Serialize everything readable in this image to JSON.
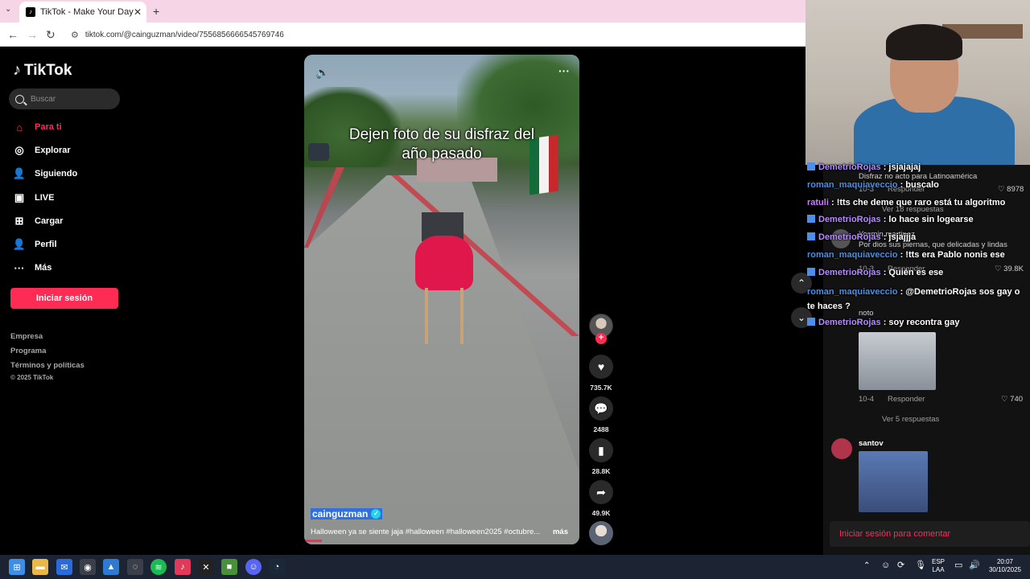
{
  "browser": {
    "tab_title": "TikTok - Make Your Day",
    "url": "tiktok.com/@cainguzman/video/7556856666545769746"
  },
  "sidebar": {
    "logo": "TikTok",
    "search_placeholder": "Buscar",
    "items": [
      {
        "label": "Para ti",
        "icon": "home-icon"
      },
      {
        "label": "Explorar",
        "icon": "compass-icon"
      },
      {
        "label": "Siguiendo",
        "icon": "following-icon"
      },
      {
        "label": "LIVE",
        "icon": "live-icon"
      },
      {
        "label": "Cargar",
        "icon": "upload-icon"
      },
      {
        "label": "Perfil",
        "icon": "profile-icon"
      },
      {
        "label": "Más",
        "icon": "more-icon"
      }
    ],
    "login_label": "Iniciar sesión",
    "footer": [
      "Empresa",
      "Programa",
      "Términos y políticas"
    ],
    "copyright": "© 2025 TikTok"
  },
  "video": {
    "caption_line1": "Dejen foto de su disfraz del",
    "caption_line2": "año pasado",
    "author": "cainguzman",
    "description": "Halloween ya se siente jaja #halloween #halloween2025 #octubre...",
    "more_label": "más",
    "likes": "735.7K",
    "comments": "2488",
    "saves": "28.8K",
    "shares": "49.9K"
  },
  "comments": {
    "items": [
      {
        "text": "Disfraz no acto para Latinoamérica",
        "date": "10-3",
        "reply": "Responder",
        "likes": "8978"
      },
      {
        "view_replies": "Ver 18 respuestas"
      },
      {
        "user": "Yosmin martinez",
        "text": "Por dios sus piernas, que delicadas y lindas",
        "date": "10-3",
        "reply": "Responder",
        "likes": "39.8K"
      },
      {
        "user": "noto",
        "date": "10-4",
        "reply": "Responder",
        "likes": "740"
      },
      {
        "view_replies": "Ver 5 respuestas"
      },
      {
        "user": "santov"
      }
    ],
    "login_prompt": "Iniciar sesión para comentar"
  },
  "chat": [
    {
      "user": "DemetrioRojas",
      "msg": ": jsjajajaj",
      "badge": true
    },
    {
      "user": "roman_maquiaveccio",
      "msg": ": buscalo",
      "badge": false
    },
    {
      "user": "ratuli",
      "msg": ": !tts che deme que raro está tu algoritmo",
      "badge": false
    },
    {
      "user": "DemetrioRojas",
      "msg": ": lo hace sin logearse",
      "badge": true
    },
    {
      "user": "DemetrioRojas",
      "msg": ": jsjajjja",
      "badge": true
    },
    {
      "user": "roman_maquiaveccio",
      "msg": ": !tts era Pablo nonis ese",
      "badge": false
    },
    {
      "user": "DemetrioRojas",
      "msg": ": Quién es ese",
      "badge": true
    },
    {
      "user": "roman_maquiaveccio",
      "msg": ": @DemetrioRojas sos gay o te haces ?",
      "badge": false
    },
    {
      "user": "DemetrioRojas",
      "msg": ": soy recontra gay",
      "badge": true
    }
  ],
  "taskbar": {
    "lang": "ESP",
    "layout": "LAA",
    "time": "20:07",
    "date": "30/10/2025"
  },
  "colors": {
    "accent": "#fe2c55",
    "tab_strip": "#f6d6e6",
    "taskbar": "#1c2433"
  }
}
